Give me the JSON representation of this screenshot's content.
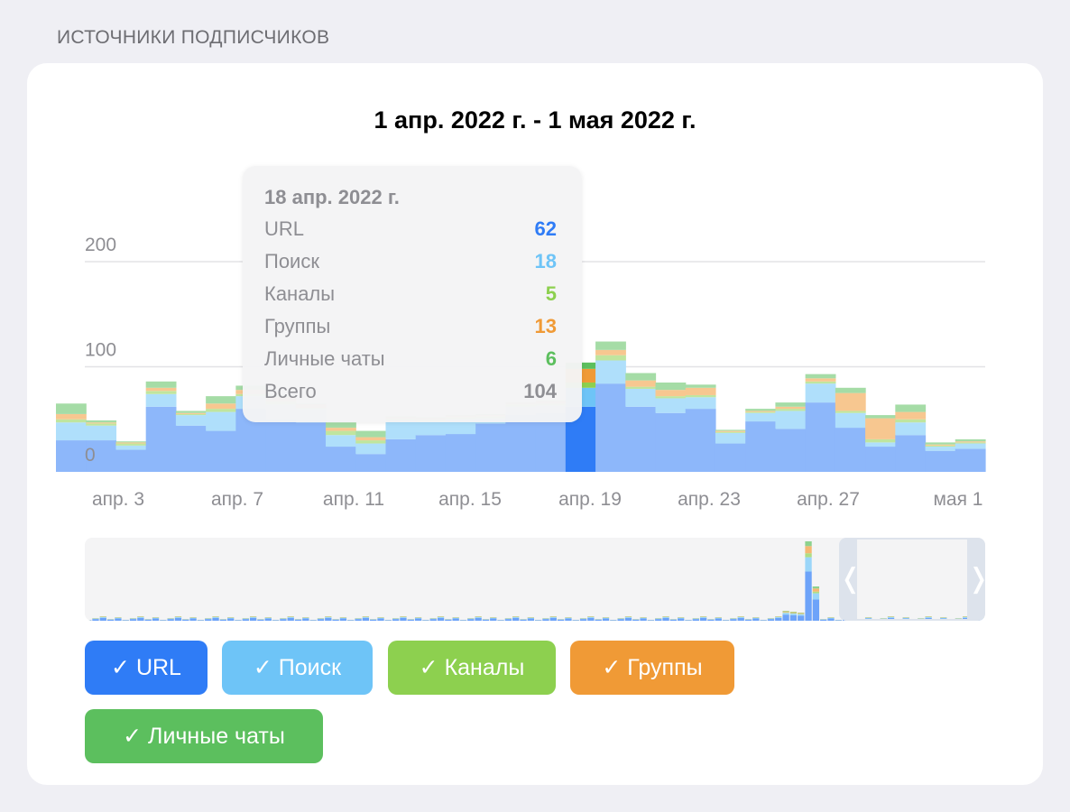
{
  "section_title": "ИСТОЧНИКИ ПОДПИСЧИКОВ",
  "colors": {
    "url": "#2f7cf6",
    "search": "#6ec4f7",
    "channels": "#8dd04f",
    "groups": "#f09a36",
    "private": "#5cbf5e",
    "total": "#8e8e93"
  },
  "tooltip": {
    "date": "18 апр. 2022 г.",
    "rows": [
      {
        "name": "URL",
        "value": "62"
      },
      {
        "name": "Поиск",
        "value": "18"
      },
      {
        "name": "Каналы",
        "value": "5"
      },
      {
        "name": "Группы",
        "value": "13"
      },
      {
        "name": "Личные чаты",
        "value": "6"
      },
      {
        "name": "Всего",
        "value": "104"
      }
    ]
  },
  "navigator": {
    "left_handle_icon": "chevron-left-icon",
    "right_handle_icon": "chevron-right-icon",
    "left_glyph": "❬",
    "right_glyph": "❭"
  },
  "toggles": [
    {
      "label": "✓ URL"
    },
    {
      "label": "✓ Поиск"
    },
    {
      "label": "✓ Каналы"
    },
    {
      "label": "✓ Группы"
    },
    {
      "label": "✓ Личные чаты"
    }
  ],
  "chart_data": {
    "type": "bar",
    "stacked": true,
    "title": "1 апр. 2022 г. - 1 мая 2022 г.",
    "x_ticks": [
      "апр. 3",
      "апр. 7",
      "апр. 11",
      "апр. 15",
      "апр. 19",
      "апр. 23",
      "апр. 27",
      "мая 1"
    ],
    "y_ticks": [
      "0",
      "100",
      "200"
    ],
    "ylim": [
      0,
      200
    ],
    "grid": true,
    "highlighted_index": 17,
    "series": [
      {
        "name": "URL",
        "color": "#2f7cf6",
        "values": [
          30,
          30,
          21,
          62,
          44,
          39,
          60,
          50,
          47,
          24,
          17,
          31,
          35,
          36,
          46,
          54,
          56,
          62,
          84,
          62,
          56,
          60,
          27,
          48,
          41,
          66,
          42,
          24,
          35,
          20,
          22
        ]
      },
      {
        "name": "Поиск",
        "color": "#6ec4f7",
        "values": [
          17,
          14,
          4,
          12,
          10,
          18,
          12,
          14,
          13,
          11,
          10,
          18,
          13,
          14,
          5,
          8,
          7,
          18,
          22,
          17,
          14,
          11,
          10,
          8,
          17,
          18,
          14,
          4,
          12,
          4,
          5
        ]
      },
      {
        "name": "Каналы",
        "color": "#8dd04f",
        "values": [
          3,
          2,
          2,
          3,
          1,
          3,
          2,
          3,
          1,
          4,
          3,
          2,
          2,
          2,
          2,
          2,
          2,
          5,
          5,
          2,
          2,
          2,
          1,
          1,
          2,
          2,
          2,
          3,
          3,
          1,
          1
        ]
      },
      {
        "name": "Группы",
        "color": "#f09a36",
        "values": [
          5,
          1,
          1,
          3,
          1,
          5,
          4,
          4,
          3,
          3,
          3,
          1,
          1,
          1,
          1,
          1,
          2,
          13,
          5,
          6,
          6,
          7,
          1,
          1,
          2,
          3,
          17,
          20,
          7,
          1,
          1
        ]
      },
      {
        "name": "Личные чаты",
        "color": "#5cbf5e",
        "values": [
          10,
          2,
          1,
          6,
          2,
          7,
          4,
          2,
          1,
          5,
          6,
          1,
          1,
          1,
          1,
          1,
          1,
          6,
          8,
          7,
          7,
          3,
          1,
          2,
          4,
          4,
          5,
          3,
          7,
          2,
          2
        ]
      }
    ]
  }
}
